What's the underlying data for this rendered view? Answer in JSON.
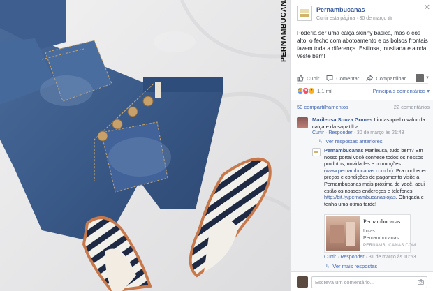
{
  "photo": {
    "brand_vertical": "PERNAMBUCANAS"
  },
  "post": {
    "page_name": "Pernambucanas",
    "like_page": "Curtir esta página",
    "date": "30 de março",
    "text": "Poderia ser uma calça skinny básica, mas o cós alto, o fecho com abotoamento e os bolsos frontais fazem toda a diferença. Estilosa, inusitada e ainda veste bem!"
  },
  "actions": {
    "like": "Curtir",
    "comment": "Comentar",
    "share": "Compartilhar"
  },
  "reactions": {
    "count": "1,1 mil",
    "relevant": "Principais comentários",
    "relevant_arrow": "▾"
  },
  "stats": {
    "shares": "50 compartilhamentos",
    "comments": "22 comentários"
  },
  "comments": [
    {
      "name": "Marileusa Souza Gomes",
      "text": "Lindas qual o valor da calça e da sapatilha .",
      "like": "Curtir",
      "reply": "Responder",
      "time": "30 de março às 21:43",
      "prev_replies": "Ver respostas anteriores"
    }
  ],
  "reply": {
    "name": "Pernambucanas",
    "text_1": "Marileusa, tudo bem? Em nosso portal você conhece todos os nossos produtos, novidades e promoções (",
    "url_1": "www.pernambucanas.com.br",
    "text_2": "). Pra conhecer preços e condições de pagamento visite a Pernambucanas mais próxima de você, aqui estão os nossos endereços e telefones:",
    "url_2": "http://bit.ly/pernambucanaslojas",
    "text_3": ". Obrigada e tenha uma ótima tarde!",
    "card_title": "Pernambucanas",
    "card_sub": "Lojas Pernambucanas:...",
    "card_domain": "PERNAMBUCANAS.COM...",
    "like": "Curtir",
    "reply": "Responder",
    "time": "31 de março às 10:53",
    "more_replies": "Ver mais respostas"
  },
  "composer": {
    "placeholder": "Escreva um comentário..."
  },
  "colors": {
    "link": "#365899",
    "accent": "#4267b2",
    "meta": "#90949c"
  },
  "icons": [
    "close-icon",
    "like-icon",
    "comment-icon",
    "share-icon",
    "globe-icon",
    "camera-icon",
    "reply-arrow-icon",
    "chevron-down-icon"
  ]
}
